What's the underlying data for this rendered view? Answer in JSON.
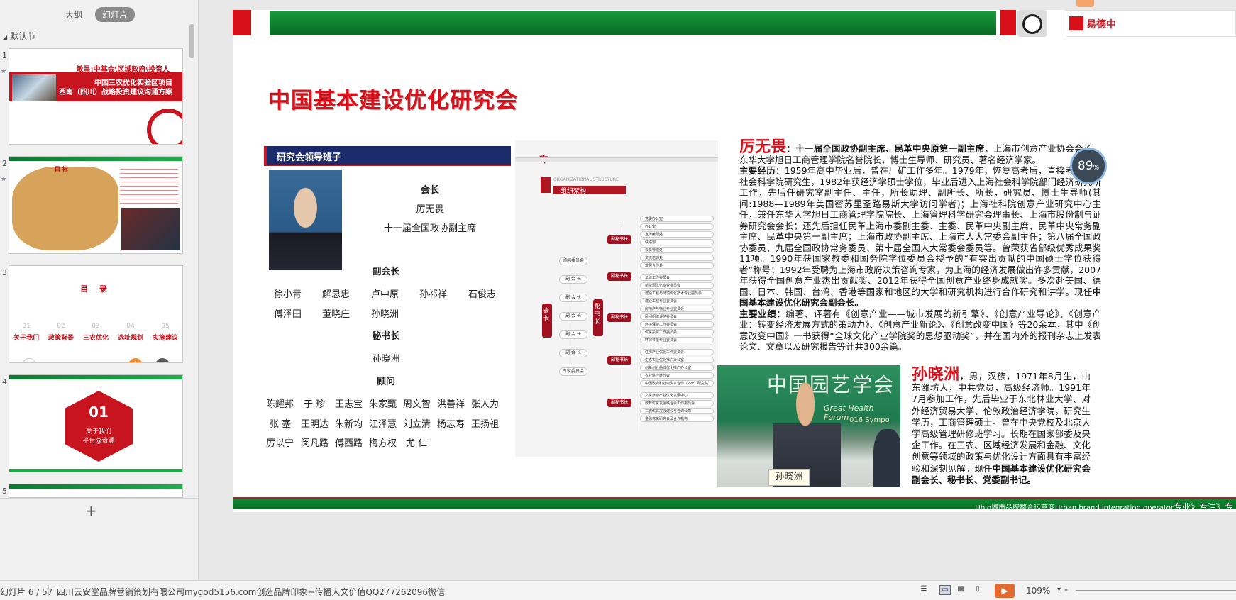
{
  "left_pane": {
    "tabs": [
      "大纲",
      "幻灯片"
    ],
    "active_tab": "幻灯片",
    "section": "默认节",
    "thumbnails": [
      {
        "num": "1",
        "text1": "敬呈:中基会\\区域政府\\投资人",
        "text2": "中国三农优化实验区项目",
        "text3": "西南（四川）战略投资建议沟通方案"
      },
      {
        "num": "2",
        "label": "目 标"
      },
      {
        "num": "3",
        "title": "目 录",
        "items": [
          {
            "n": "01",
            "label": "关于我们"
          },
          {
            "n": "02",
            "label": "政策背景"
          },
          {
            "n": "03",
            "label": "三农优化"
          },
          {
            "n": "04",
            "label": "选址规划"
          },
          {
            "n": "05",
            "label": "实施建议"
          }
        ]
      },
      {
        "num": "4",
        "big": "01",
        "sub1": "关于我们",
        "sub2": "平台@资源"
      },
      {
        "num": "5"
      }
    ]
  },
  "slide": {
    "title": "中国基本建设优化研究会",
    "logo_text": "易德中",
    "leader_header": "研究会领导班子",
    "president_title": "会长",
    "president_name": "厉无畏",
    "president_role": "十一届全国政协副主席",
    "vice_title": "副会长",
    "vice_row1": [
      "徐小青",
      "解思忠",
      "卢中原",
      "孙祁祥",
      "石俊志"
    ],
    "vice_row2": [
      "傅泽田",
      "董晓庄",
      "孙晓洲"
    ],
    "secretary_title": "秘书长",
    "secretary_name": "孙晓洲",
    "advisor_title": "顾问",
    "advisor_row1": [
      "陈耀邦",
      "于 珍",
      "王志宝",
      "朱家甄",
      "周文智",
      "洪善祥",
      "张人为"
    ],
    "advisor_row2": [
      "张 塞",
      "王明达",
      "朱新均",
      "江泽慧",
      "刘立清",
      "杨志寿",
      "王扬祖"
    ],
    "advisor_row3": [
      "厉以宁",
      "闵凡路",
      "傅西路",
      "梅方权",
      "尤 仁"
    ],
    "org_chart": {
      "header_tag": "昨",
      "eng": "ORGANIZATIONAL STRUCTURE",
      "title": "组织架构",
      "root": "会长",
      "mid": "秘书长",
      "left_nodes": [
        "顾问委员会",
        "副 会 长",
        "副 会 长",
        "副 会 长",
        "副 会 长",
        "副 会 长",
        "专家委员会"
      ],
      "l2_nodes": [
        "副秘书长",
        "副秘书长",
        "副秘书长",
        "副秘书长",
        "副秘书长"
      ],
      "right_nodes": [
        "党委办公室",
        "办公室",
        "宣传编研处",
        "联络部",
        "会员管理处",
        "交流培训处",
        "发展合作处",
        "法律工作委员会",
        "新能源优化专业委员会",
        "建设工程与环境优化技术专业委员会",
        "建设工程专业委员会",
        "房地产与物业专业委员会",
        "民间组织评估委员会",
        "环境保护工作委员会",
        "优化投资工作委员会",
        "环保节能专业委员会",
        "住房产业优化工作委员会",
        "生态农业优化推广办公室",
        "创新创业品牌优化推广办公室",
        "农业供应链分会",
        "中国政府和社会资本合作（PPP）研究院",
        "文化旅游产业优化发展中心",
        "教育优化发展联合会工作委员会",
        "三农优化发展建设与咨询公司",
        "金融优化研究会及合作机构"
      ]
    },
    "bio1": {
      "name": "厉无畏",
      "intro_bold": "十一届全国政协副主席、民革中央原第一副主席",
      "intro_rest": "，上海市创意产业协会会长、东华大学旭日工商管理学院名誉院长，博士生导师、研究员、著名经济学家。",
      "exp_label": "主要经历",
      "exp_text": "：1959年高中毕业后，曾在厂矿工作多年。1979年，恢复高考后，直接考入上海社会科学院研究生，1982年获经济学硕士学位，毕业后进入上海社会科学院部门经济研究所工作，先后任研究室副主任、主任，所长助理、副所长、所长，研究员、博士生导师(其间:1988—1989年美国密苏里圣路易斯大学访问学者)；上海社科院创意产业研究中心主任，兼任东华大学旭日工商管理学院院长、上海管理科学研究会理事长、上海市股份制与证券研究会会长；还先后担任民革上海市委副主委、主委、民革中央副主席、民革中央常务副主席、民革中央第一副主席；上海市政协副主席、上海市人大常委会副主任；第八届全国政协委员、九届全国政协常务委员、第十届全国人大常委会委员等。曾荣获省部级优秀成果奖11项。1990年获国家教委和国务院学位委员会授予的“有突出贡献的中国硕士学位获得者”称号；1992年受聘为上海市政府决策咨询专家，为上海的经济发展做出许多贡献，2007年获得全国创意产业杰出贡献奖、2012年获得全国创意产业终身成就奖。多次赴美国、德国、日本、韩国、台湾、香港等国家和地区的大学和研究机构进行合作研究和讲学。现任",
      "exp_bold": "中国基本建设优化研究会副会长。",
      "work_label": "主要业绩",
      "work_text": "：编著、译著有《创意产业——城市发展的新引擎》、《创意产业导论》、《创意产业：转变经济发展方式的策动力》、《创意产业新论》、《创意改变中国》等20余本，其中《创意改变中国》一书获得“全球文化产业学院奖的思想驱动奖”，并在国内外的报刊杂志上发表论文、文章以及研究报告等计共300余篇。"
    },
    "photo2": {
      "banner": "中国园艺学会",
      "banner_sub": "Great Health Forum",
      "banner_sub2": "016 Sympo",
      "nameplate": "孙晓洲"
    },
    "bio2": {
      "name": "孙晓洲",
      "text": "，男，汉族，1971年8月生，山东潍坊人，中共党员，高级经济师。1991年7月参加工作，先后毕业于东北林业大学、对外经济贸易大学、伦敦政治经济学院，研究生学历，工商管理硕士。曾在中央党校及北京大学高级管理研修班学习。长期在国家部委及央企工作。在三农、区域经济发展和金融、文化创意等领域的政策与优化设计方面具有丰富经验和深刻见解。现任",
      "text_bold": "中国基本建设优化研究会副会长、秘书长、党委副书记。"
    },
    "footer": {
      "left": "Ubio城市品牌整合运营商Urban brand integration operator",
      "right": "专业》专注》专"
    }
  },
  "overlay": {
    "gauge_value": "89",
    "gauge_unit": "%"
  },
  "statusbar": {
    "slide_pos": "幻灯片 6 / 57",
    "notes": "四川云安堂品牌营销策划有限公司mygod5156.com创造品牌印象+传播人文价值QQ277262096微信",
    "zoom": "109%"
  }
}
